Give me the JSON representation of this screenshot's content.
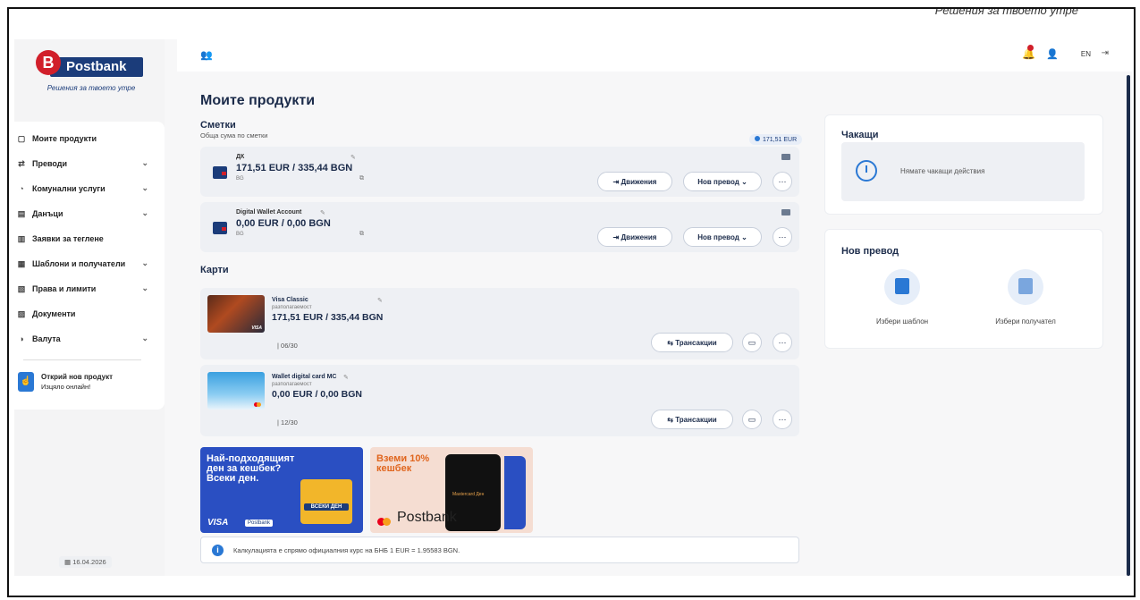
{
  "header_tagline": "Решения за твоето утре",
  "brand": {
    "logo_letter": "B",
    "name": "Postbank",
    "slogan": "Решения за твоето утре"
  },
  "sidebar": {
    "items": [
      {
        "label": "Моите продукти",
        "icon": "grid-icon",
        "expandable": false
      },
      {
        "label": "Преводи",
        "icon": "transfer-icon",
        "expandable": true
      },
      {
        "label": "Комунални услуги",
        "icon": "utility-icon",
        "expandable": true
      },
      {
        "label": "Данъци",
        "icon": "tax-icon",
        "expandable": true
      },
      {
        "label": "Заявки за теглене",
        "icon": "withdraw-icon",
        "expandable": false
      },
      {
        "label": "Шаблони и получатели",
        "icon": "template-icon",
        "expandable": true
      },
      {
        "label": "Права и лимити",
        "icon": "rights-icon",
        "expandable": true
      },
      {
        "label": "Документи",
        "icon": "document-icon",
        "expandable": false
      },
      {
        "label": "Валута",
        "icon": "currency-icon",
        "expandable": true
      }
    ],
    "promo": {
      "title": "Открий нов продукт",
      "subtitle": "Изцяло онлайн!"
    },
    "date": "16.04.2026"
  },
  "topbar": {
    "lang": "EN",
    "notifications_badge": true
  },
  "page": {
    "title": "Моите продукти"
  },
  "accounts": {
    "title": "Сметки",
    "subtitle": "Обща сума по сметки",
    "total": "171,51 EUR",
    "rows": [
      {
        "name": "ДК",
        "amount": "171,51 EUR / 335,44 BGN",
        "iban": "BG",
        "btn_movements": "Движения",
        "btn_transfer": "Нов превод"
      },
      {
        "name": "Digital Wallet Account",
        "amount": "0,00 EUR / 0,00 BGN",
        "iban": "BG",
        "btn_movements": "Движения",
        "btn_transfer": "Нов превод"
      }
    ]
  },
  "cards": {
    "title": "Карти",
    "rows": [
      {
        "name": "Visa Classic",
        "label": "разполагаемост",
        "amount": "171,51 EUR / 335,44 BGN",
        "expiry": "| 06/30",
        "btn_transactions": "Трансакции"
      },
      {
        "name": "Wallet digital card MC",
        "label": "разполагаемост",
        "amount": "0,00 EUR / 0,00 BGN",
        "expiry": "| 12/30",
        "btn_transactions": "Трансакции"
      }
    ]
  },
  "banners": {
    "one": {
      "text": "Най-подходящият ден за кешбек? Всеки ден.",
      "badge": "ВСЕКИ ДЕН",
      "visa": "VISA",
      "brand": "Postbank"
    },
    "two": {
      "text": "Вземи 10% кешбек",
      "phone_text": "Mastercard Ден",
      "brand": "Postbank"
    }
  },
  "info": {
    "text": "Калкулацията е спрямо официалния курс на БНБ 1 EUR = 1.95583 BGN."
  },
  "pending": {
    "title": "Чакащи",
    "empty_text": "Нямате чакащи действия"
  },
  "new_transfer": {
    "title": "Нов превод",
    "options": [
      {
        "label": "Избери шаблон",
        "icon": "template-icon"
      },
      {
        "label": "Избери получател",
        "icon": "recipient-icon"
      }
    ]
  },
  "colors": {
    "brand_blue": "#1b3c7a",
    "brand_red": "#d11f2a",
    "accent": "#2a78d4"
  }
}
